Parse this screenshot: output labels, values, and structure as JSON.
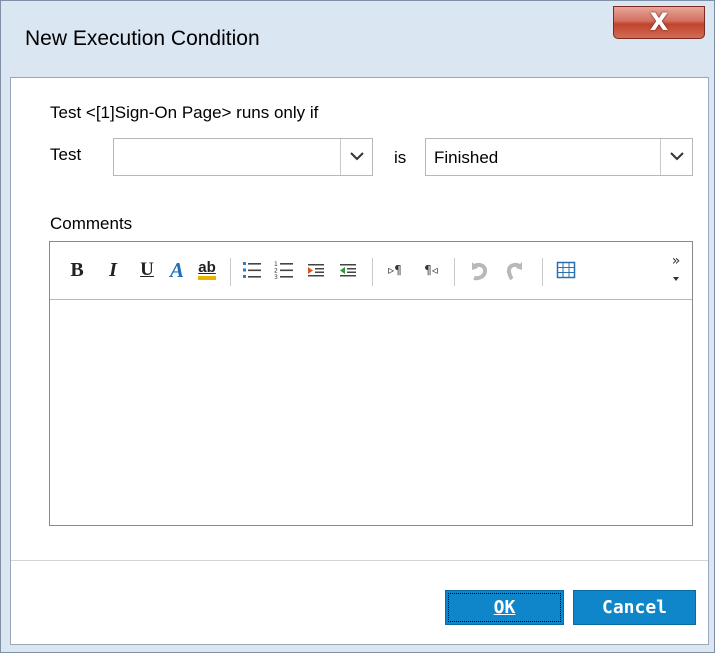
{
  "window": {
    "title": "New Execution Condition",
    "close_glyph": "X"
  },
  "condition": {
    "intro": "Test <[1]Sign-On Page> runs only if",
    "test_label": "Test",
    "test_value": "",
    "is_label": "is",
    "status_value": "Finished"
  },
  "comments": {
    "label": "Comments",
    "text": "",
    "toolbar": [
      {
        "name": "bold-icon",
        "glyph": "B"
      },
      {
        "name": "italic-icon",
        "glyph": "I"
      },
      {
        "name": "underline-icon",
        "glyph": "U"
      },
      {
        "name": "font-color-icon",
        "glyph": "A"
      },
      {
        "name": "highlight-icon",
        "glyph": "ab"
      },
      {
        "name": "bullet-list-icon"
      },
      {
        "name": "numbered-list-icon"
      },
      {
        "name": "decrease-indent-icon"
      },
      {
        "name": "increase-indent-icon"
      },
      {
        "name": "ltr-paragraph-icon",
        "glyph": "▹¶"
      },
      {
        "name": "rtl-paragraph-icon",
        "glyph": "¶◃"
      },
      {
        "name": "undo-icon"
      },
      {
        "name": "redo-icon"
      },
      {
        "name": "table-icon"
      },
      {
        "name": "more-options-icon",
        "glyph": "»"
      }
    ]
  },
  "buttons": {
    "ok_label": "OK",
    "cancel_label": "Cancel"
  },
  "colors": {
    "accent_button": "#0f86c9",
    "close_button": "#c1432d",
    "frame": "#dbe6f3"
  }
}
